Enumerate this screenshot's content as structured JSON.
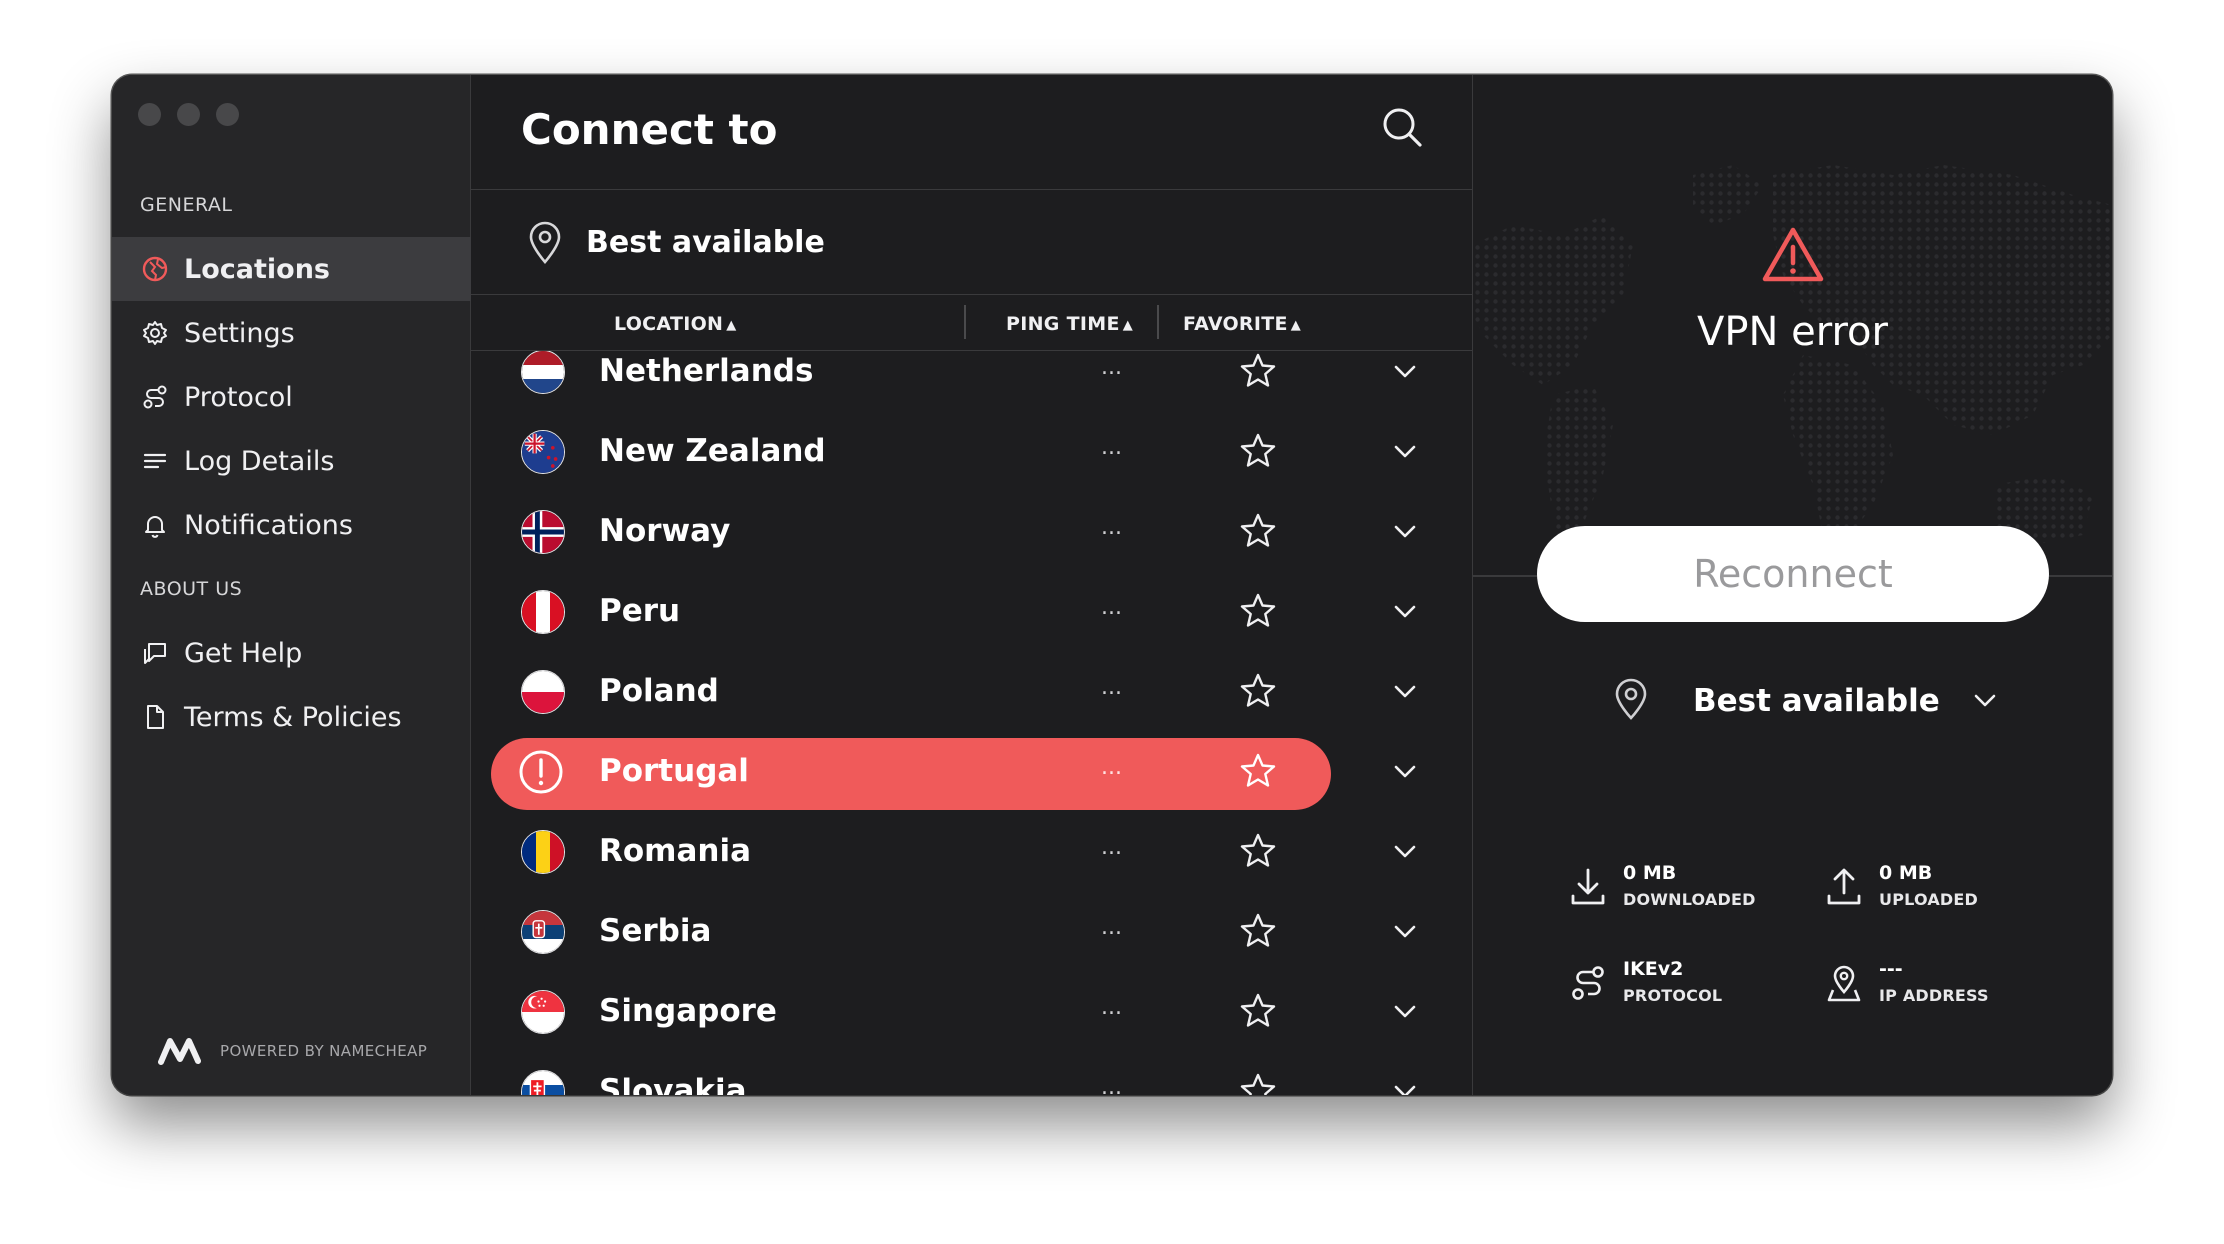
{
  "sidebar": {
    "general_label": "GENERAL",
    "about_label": "ABOUT US",
    "items": [
      {
        "label": "Locations"
      },
      {
        "label": "Settings"
      },
      {
        "label": "Protocol"
      },
      {
        "label": "Log Details"
      },
      {
        "label": "Notifications"
      },
      {
        "label": "Get Help"
      },
      {
        "label": "Terms & Policies"
      }
    ],
    "powered_by": "POWERED BY NAMECHEAP"
  },
  "main": {
    "title": "Connect to",
    "best_available": "Best available",
    "columns": {
      "location": "LOCATION",
      "ping": "PING TIME",
      "favorite": "FAVORITE"
    },
    "countries": [
      {
        "name": "Netherlands",
        "ping": "..."
      },
      {
        "name": "New Zealand",
        "ping": "..."
      },
      {
        "name": "Norway",
        "ping": "..."
      },
      {
        "name": "Peru",
        "ping": "..."
      },
      {
        "name": "Poland",
        "ping": "..."
      },
      {
        "name": "Portugal",
        "ping": "..."
      },
      {
        "name": "Romania",
        "ping": "..."
      },
      {
        "name": "Serbia",
        "ping": "..."
      },
      {
        "name": "Singapore",
        "ping": "..."
      },
      {
        "name": "Slovakia",
        "ping": "..."
      }
    ]
  },
  "right": {
    "status": "VPN error",
    "reconnect_label": "Reconnect",
    "location": "Best available",
    "stats": {
      "downloaded": {
        "value": "0 MB",
        "label": "DOWNLOADED"
      },
      "uploaded": {
        "value": "0 MB",
        "label": "UPLOADED"
      },
      "protocol": {
        "value": "IKEv2",
        "label": "PROTOCOL"
      },
      "ip": {
        "value": "---",
        "label": "IP ADDRESS"
      }
    }
  },
  "colors": {
    "accent": "#f05a5a",
    "background": "#1d1d1f",
    "sidebar": "#262628"
  }
}
